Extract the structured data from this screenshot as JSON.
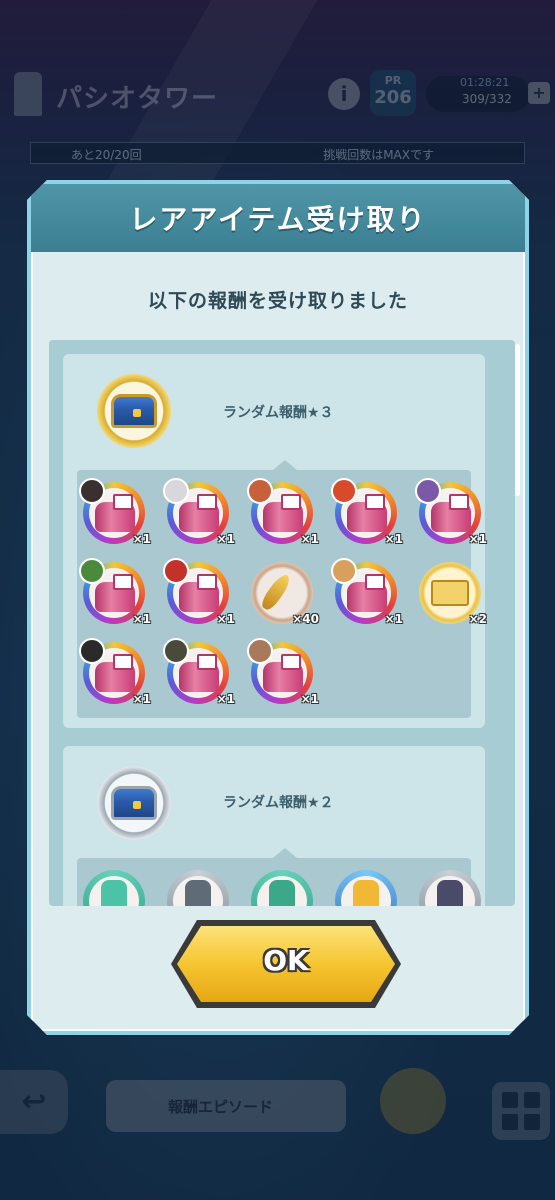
{
  "background": {
    "game_title": "パシオタワー",
    "info_icon": "i",
    "pr_label": "PR",
    "pr_value": "206",
    "stamina_time": "01:28:21",
    "stamina_count": "309/332",
    "plus_icon": "+",
    "attempts_left": "あと20/20回",
    "challenge_status": "挑戦回数はMAXです",
    "episode_button": "報酬エピソード",
    "back_icon": "↩"
  },
  "modal": {
    "title": "レアアイテム受け取り",
    "subtitle": "以下の報酬を受け取りました",
    "ok_label": "OK"
  },
  "groups": [
    {
      "label": "ランダム報酬★３",
      "chest": "gold-treasure-chest-icon",
      "items": [
        {
          "name": "outfit-item",
          "qty": "×1"
        },
        {
          "name": "outfit-item",
          "qty": "×1"
        },
        {
          "name": "outfit-item",
          "qty": "×1"
        },
        {
          "name": "outfit-item",
          "qty": "×1"
        },
        {
          "name": "outfit-item",
          "qty": "×1"
        },
        {
          "name": "outfit-item",
          "qty": "×1"
        },
        {
          "name": "outfit-item",
          "qty": "×1"
        },
        {
          "name": "gold-feather-item",
          "qty": "×40"
        },
        {
          "name": "outfit-item",
          "qty": "×1"
        },
        {
          "name": "ticket-item",
          "qty": "×2"
        },
        {
          "name": "outfit-item",
          "qty": "×1"
        },
        {
          "name": "outfit-item",
          "qty": "×1"
        },
        {
          "name": "outfit-item",
          "qty": "×1"
        }
      ]
    },
    {
      "label": "ランダム報酬★２",
      "chest": "silver-treasure-chest-icon"
    }
  ],
  "colors": {
    "accent_teal": "#4f96a8",
    "ok_yellow": "#f6c531"
  }
}
